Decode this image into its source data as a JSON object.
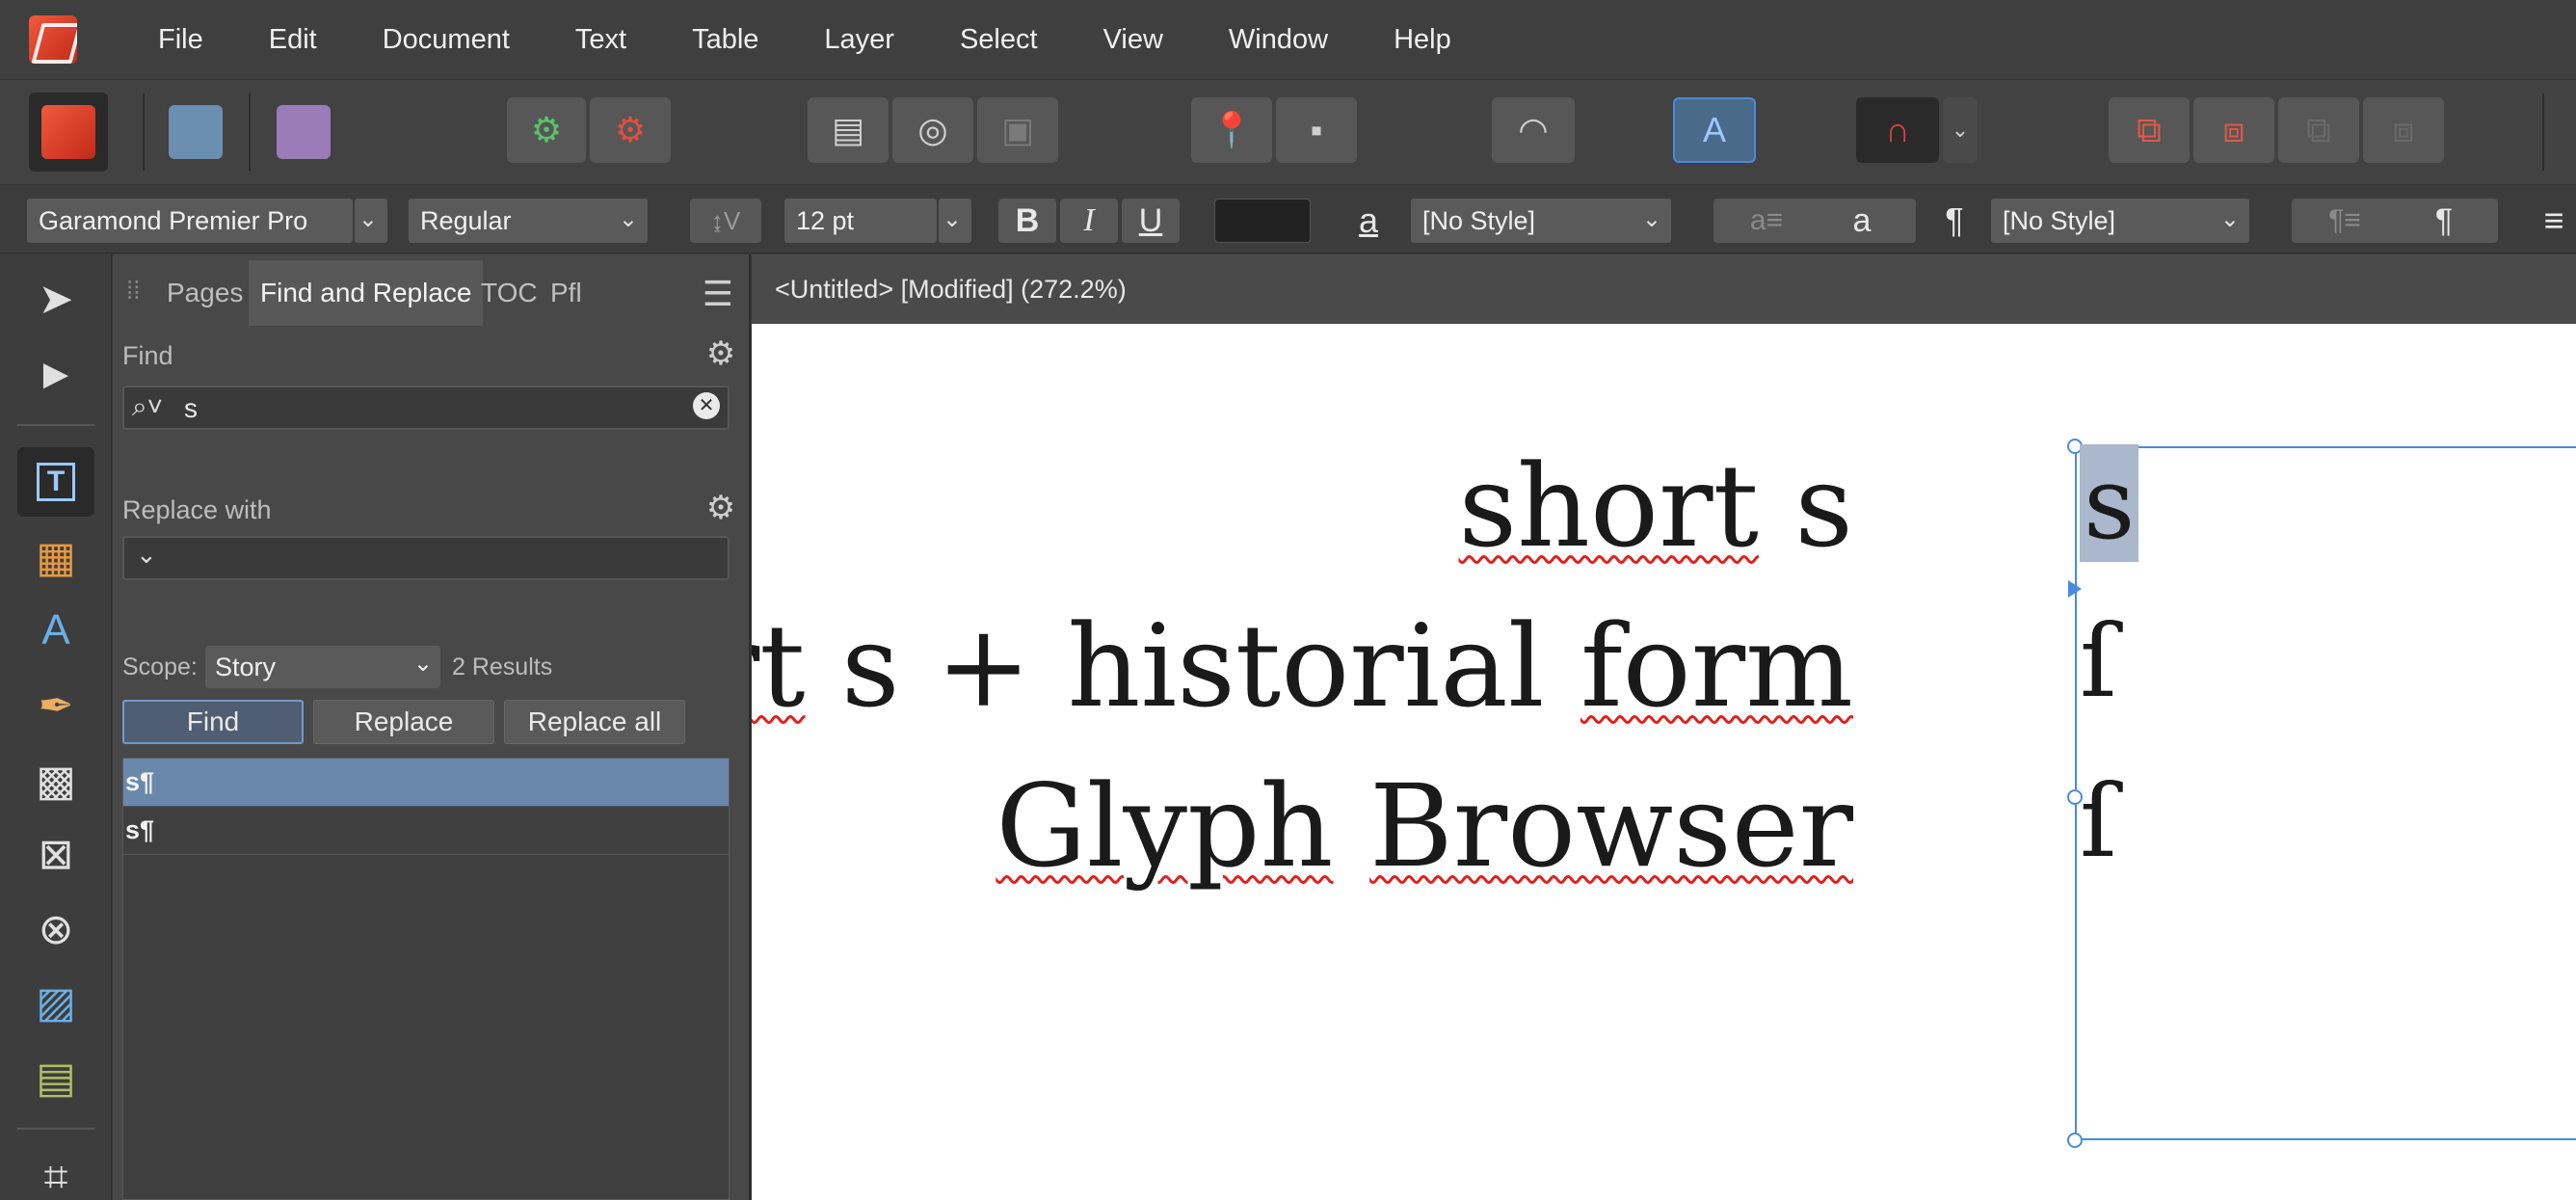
{
  "menu": {
    "items": [
      "File",
      "Edit",
      "Document",
      "Text",
      "Table",
      "Layer",
      "Select",
      "View",
      "Window",
      "Help"
    ]
  },
  "context_toolbar": {
    "font_family": "Garamond Premier Pro",
    "font_style": "Regular",
    "font_size": "12 pt",
    "bold": "B",
    "italic": "I",
    "underline": "U",
    "char_style_glyph": "a",
    "char_style": "[No Style]",
    "char_style_preview": "a",
    "pilcrow": "¶",
    "para_style": "[No Style]",
    "para_style_preview": "¶",
    "text_color": "#222222"
  },
  "panel": {
    "tabs": [
      "Pages",
      "Find and Replace",
      "TOC",
      "Pfl"
    ],
    "active_tab": "Find and Replace",
    "find_label": "Find",
    "find_value": "s",
    "replace_label": "Replace with",
    "replace_value": "",
    "scope_label": "Scope:",
    "scope_value": "Story",
    "results_count": "2 Results",
    "find_button": "Find",
    "replace_button": "Replace",
    "replace_all_button": "Replace all",
    "results": [
      "s¶",
      "s¶"
    ]
  },
  "document": {
    "title": "<Untitled> [Modified] (272.2%)",
    "line1_a": "short",
    "line1_b": " s",
    "line2_a": "short",
    "line2_b": " s + historial ",
    "line2_c": "form",
    "line3_a": "Glyph",
    "line3_b": " ",
    "line3_c": "Browser",
    "glyph1": "s",
    "glyph2": "ſ",
    "glyph3": "ſ"
  },
  "colors": {
    "accent": "#4a8ae0",
    "selection": "#6a88ab",
    "highlight": "#aab7cc"
  }
}
